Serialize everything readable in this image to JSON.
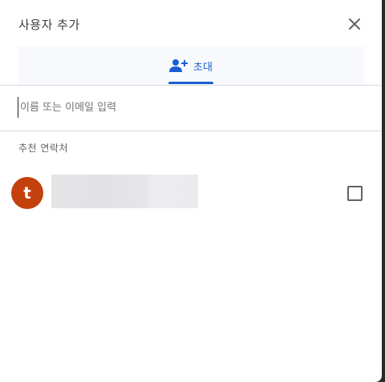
{
  "dialog": {
    "title": "사용자 추가",
    "close_icon": "close-icon"
  },
  "tabs": [
    {
      "label": "초대",
      "icon": "person-add-icon",
      "active": true
    }
  ],
  "search": {
    "placeholder": "이름 또는 이메일 입력",
    "value": ""
  },
  "suggestions": {
    "label": "추천 연락처",
    "contacts": [
      {
        "initial": "t",
        "avatar_color": "#c2410c",
        "checked": false
      }
    ]
  },
  "colors": {
    "accent": "#1a5fcf",
    "avatar": "#c2410c",
    "text_primary": "#3c4043",
    "text_secondary": "#5f6368"
  }
}
